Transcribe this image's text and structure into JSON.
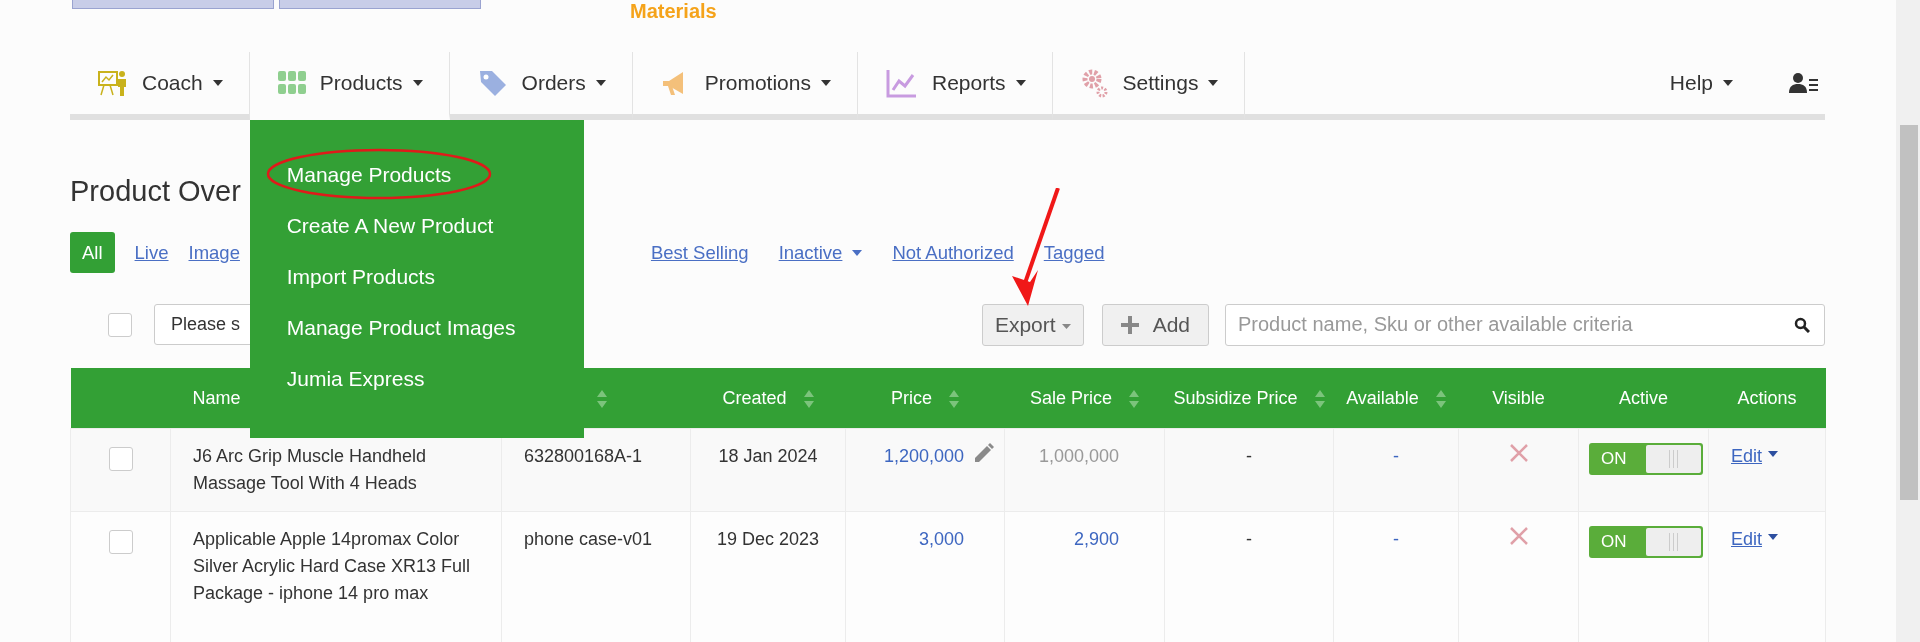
{
  "header": {
    "brand_text": "Materials"
  },
  "nav": {
    "items": [
      {
        "label": "Coach",
        "selected": false
      },
      {
        "label": "Products",
        "selected": true
      },
      {
        "label": "Orders",
        "selected": false
      },
      {
        "label": "Promotions",
        "selected": false
      },
      {
        "label": "Reports",
        "selected": false
      },
      {
        "label": "Settings",
        "selected": false
      }
    ],
    "help": "Help"
  },
  "menu": {
    "items": [
      {
        "label": "Manage Products",
        "circled": true
      },
      {
        "label": "Create A New Product",
        "circled": false
      },
      {
        "label": "Import Products",
        "circled": false
      },
      {
        "label": "Manage Product Images",
        "circled": false
      },
      {
        "label": "Jumia Express",
        "circled": false
      }
    ]
  },
  "page_title": "Product Over",
  "filters": [
    {
      "label": "All",
      "selected": true,
      "has_menu": false
    },
    {
      "label": "Live",
      "selected": false,
      "has_menu": false
    },
    {
      "label": "Image",
      "selected": false,
      "has_menu": false
    },
    {
      "label": "Best Selling",
      "selected": false,
      "has_menu": false
    },
    {
      "label": "Inactive",
      "selected": false,
      "has_menu": true
    },
    {
      "label": "Not Authorized",
      "selected": false,
      "has_menu": false
    },
    {
      "label": "Tagged",
      "selected": false,
      "has_menu": false
    }
  ],
  "toolbar": {
    "select_all_checked": false,
    "select_value": "Please s",
    "export": "Export",
    "add": "Add",
    "search_placeholder": "Product name, Sku or other available criteria"
  },
  "table": {
    "columns": [
      {
        "label": "Name",
        "sortable": false
      },
      {
        "sortable": true
      },
      {
        "label": "Created",
        "sortable": true
      },
      {
        "label": "Price",
        "sortable": true
      },
      {
        "label": "Sale Price",
        "sortable": true
      },
      {
        "label": "Subsidize Price",
        "sortable": true
      },
      {
        "label": "Available",
        "sortable": true
      },
      {
        "label": "Visible",
        "sortable": false
      },
      {
        "label": "Active",
        "sortable": false
      },
      {
        "label": "Actions",
        "sortable": false
      }
    ],
    "rows": [
      {
        "checked": false,
        "name": "J6 Arc Grip Muscle Handheld Massage Tool With 4 Heads",
        "sku": "632800168A-1",
        "created": "18 Jan 2024",
        "price": "1,200,000",
        "price_editable": true,
        "sale_price": "1,000,000",
        "sale_price_linked": false,
        "subsidize_price": "-",
        "available": "-",
        "visible": false,
        "active": true,
        "toggle_label": "ON",
        "action": "Edit"
      },
      {
        "checked": false,
        "name": "Applicable Apple 14promax Color Silver Acrylic Hard Case XR13 Full Package - iphone 14 pro max",
        "sku": "phone case-v01",
        "created": "19 Dec 2023",
        "price": "3,000",
        "price_editable": false,
        "sale_price": "2,900",
        "sale_price_linked": true,
        "subsidize_price": "-",
        "available": "-",
        "visible": false,
        "active": true,
        "toggle_label": "ON",
        "action": "Edit"
      }
    ]
  }
}
